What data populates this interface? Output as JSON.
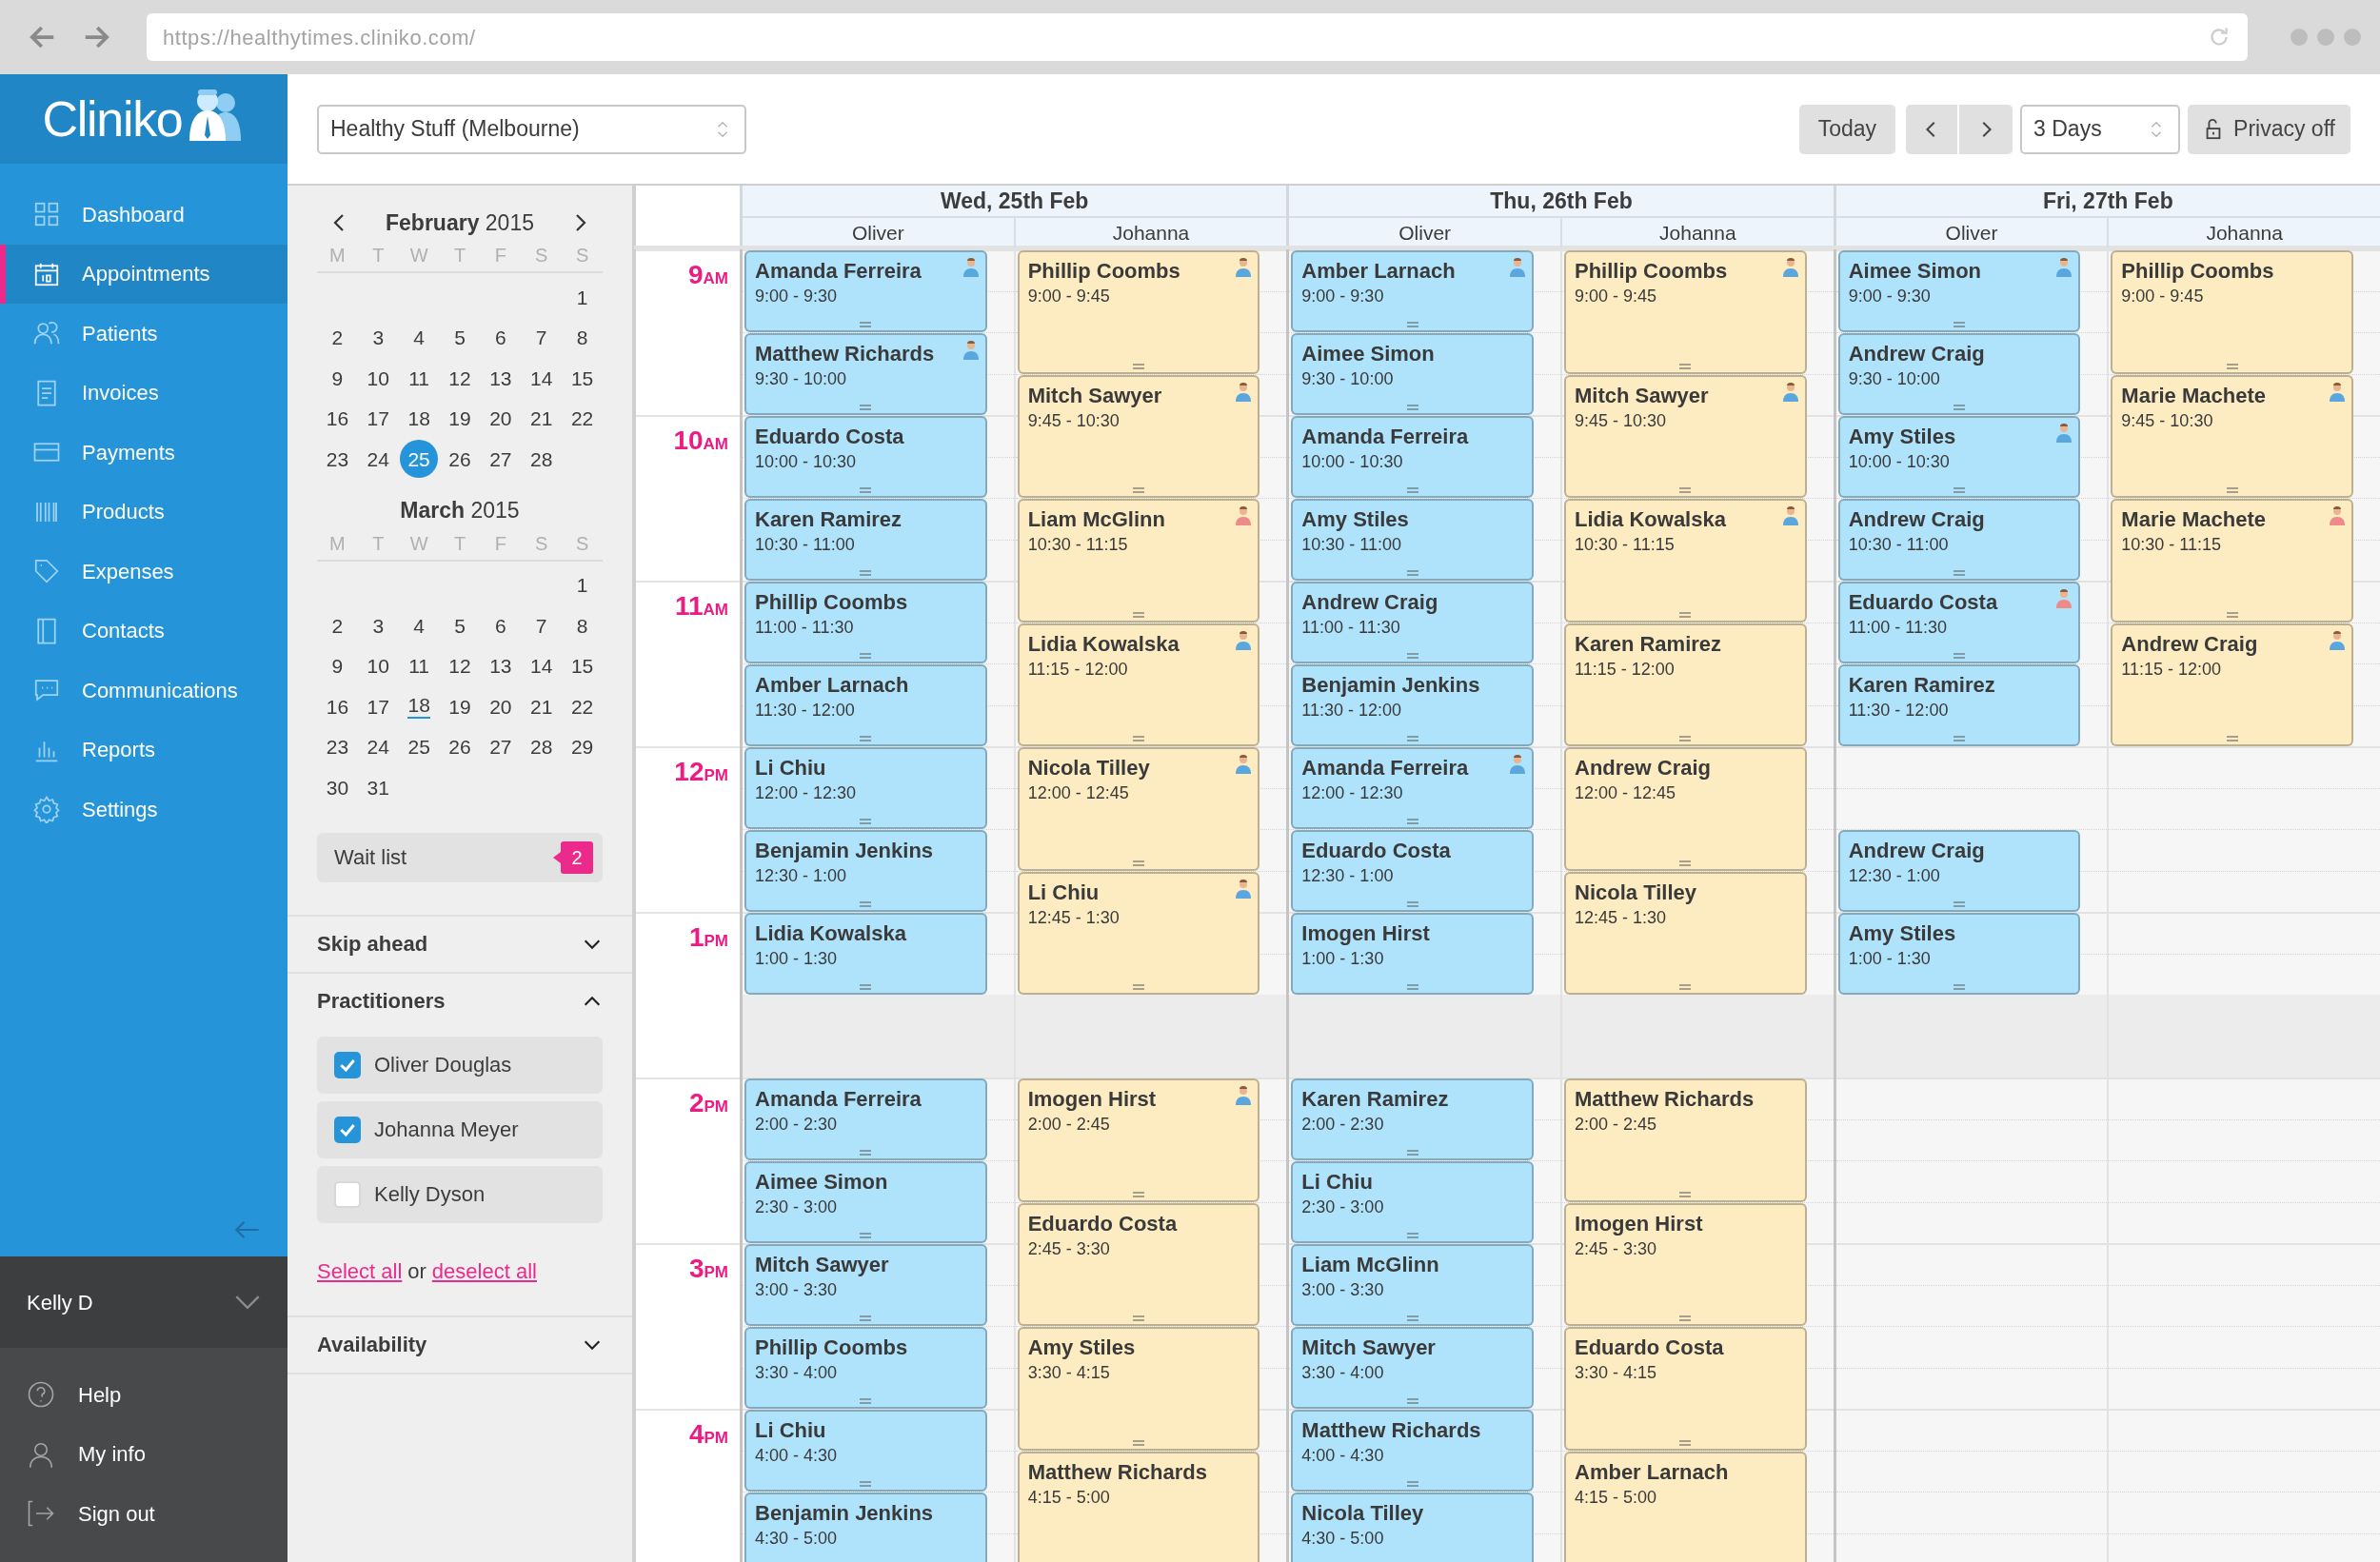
{
  "browser": {
    "url": "https://healthytimes.cliniko.com/"
  },
  "sidebar": {
    "logo": "Cliniko",
    "nav": [
      {
        "label": "Dashboard",
        "selected": false
      },
      {
        "label": "Appointments",
        "selected": true
      },
      {
        "label": "Patients",
        "selected": false
      },
      {
        "label": "Invoices",
        "selected": false
      },
      {
        "label": "Payments",
        "selected": false
      },
      {
        "label": "Products",
        "selected": false
      },
      {
        "label": "Expenses",
        "selected": false
      },
      {
        "label": "Contacts",
        "selected": false
      },
      {
        "label": "Communications",
        "selected": false
      },
      {
        "label": "Reports",
        "selected": false
      },
      {
        "label": "Settings",
        "selected": false
      }
    ],
    "user": "Kelly D",
    "footer": [
      "Help",
      "My info",
      "Sign out"
    ]
  },
  "toolbar": {
    "location": "Healthy Stuff (Melbourne)",
    "today": "Today",
    "view": "3 Days",
    "privacy": "Privacy off"
  },
  "mini_calendars": [
    {
      "title": "**February** 2015",
      "weekdays": [
        "M",
        "T",
        "W",
        "T",
        "F",
        "S",
        "S"
      ],
      "weeks": [
        [
          {
            "label": "1",
            "selected": false,
            "today": false
          }
        ],
        [
          {
            "label": "2",
            "selected": false,
            "today": false
          },
          {
            "label": "3",
            "selected": false,
            "today": false
          },
          {
            "label": "4",
            "selected": false,
            "today": false
          },
          {
            "label": "5",
            "selected": false,
            "today": false
          },
          {
            "label": "6",
            "selected": false,
            "today": false
          },
          {
            "label": "7",
            "selected": false,
            "today": false
          },
          {
            "label": "8",
            "selected": false,
            "today": false
          }
        ],
        [
          {
            "label": "9",
            "selected": false,
            "today": false
          },
          {
            "label": "10",
            "selected": false,
            "today": false
          },
          {
            "label": "11",
            "selected": false,
            "today": false
          },
          {
            "label": "12",
            "selected": false,
            "today": false
          },
          {
            "label": "13",
            "selected": false,
            "today": false
          },
          {
            "label": "14",
            "selected": false,
            "today": false
          },
          {
            "label": "15",
            "selected": false,
            "today": false
          }
        ],
        [
          {
            "label": "16",
            "selected": false,
            "today": false
          },
          {
            "label": "17",
            "selected": false,
            "today": false
          },
          {
            "label": "18",
            "selected": false,
            "today": false
          },
          {
            "label": "19",
            "selected": false,
            "today": false
          },
          {
            "label": "20",
            "selected": false,
            "today": false
          },
          {
            "label": "21",
            "selected": false,
            "today": false
          },
          {
            "label": "22",
            "selected": false,
            "today": false
          }
        ],
        [
          {
            "label": "23",
            "selected": false,
            "today": false
          },
          {
            "label": "24",
            "selected": false,
            "today": false
          },
          {
            "label": "25",
            "selected": true,
            "today": false
          },
          {
            "label": "26",
            "selected": false,
            "today": false
          },
          {
            "label": "27",
            "selected": false,
            "today": false
          },
          {
            "label": "28",
            "selected": false,
            "today": false
          }
        ]
      ]
    },
    {
      "title": "**March** 2015",
      "weekdays": [
        "M",
        "T",
        "W",
        "T",
        "F",
        "S",
        "S"
      ],
      "weeks": [
        [
          {
            "label": "1",
            "selected": false,
            "today": false
          }
        ],
        [
          {
            "label": "2",
            "selected": false,
            "today": false
          },
          {
            "label": "3",
            "selected": false,
            "today": false
          },
          {
            "label": "4",
            "selected": false,
            "today": false
          },
          {
            "label": "5",
            "selected": false,
            "today": false
          },
          {
            "label": "6",
            "selected": false,
            "today": false
          },
          {
            "label": "7",
            "selected": false,
            "today": false
          },
          {
            "label": "8",
            "selected": false,
            "today": false
          }
        ],
        [
          {
            "label": "9",
            "selected": false,
            "today": false
          },
          {
            "label": "10",
            "selected": false,
            "today": false
          },
          {
            "label": "11",
            "selected": false,
            "today": false
          },
          {
            "label": "12",
            "selected": false,
            "today": false
          },
          {
            "label": "13",
            "selected": false,
            "today": false
          },
          {
            "label": "14",
            "selected": false,
            "today": false
          },
          {
            "label": "15",
            "selected": false,
            "today": false
          }
        ],
        [
          {
            "label": "16",
            "selected": false,
            "today": false
          },
          {
            "label": "17",
            "selected": false,
            "today": false
          },
          {
            "label": "18",
            "selected": false,
            "today": true
          },
          {
            "label": "19",
            "selected": false,
            "today": false
          },
          {
            "label": "20",
            "selected": false,
            "today": false
          },
          {
            "label": "21",
            "selected": false,
            "today": false
          },
          {
            "label": "22",
            "selected": false,
            "today": false
          }
        ],
        [
          {
            "label": "23",
            "selected": false,
            "today": false
          },
          {
            "label": "24",
            "selected": false,
            "today": false
          },
          {
            "label": "25",
            "selected": false,
            "today": false
          },
          {
            "label": "26",
            "selected": false,
            "today": false
          },
          {
            "label": "27",
            "selected": false,
            "today": false
          },
          {
            "label": "28",
            "selected": false,
            "today": false
          },
          {
            "label": "29",
            "selected": false,
            "today": false
          }
        ],
        [
          {
            "label": "30",
            "selected": false,
            "today": false
          },
          {
            "label": "31",
            "selected": false,
            "today": false
          }
        ]
      ]
    }
  ],
  "wait_list": {
    "label": "Wait list",
    "count": "2"
  },
  "sections": [
    {
      "title": "Skip ahead",
      "expanded": false
    },
    {
      "title": "Practitioners",
      "expanded": true,
      "practitioners": [
        {
          "name": "Oliver Douglas",
          "checked": true
        },
        {
          "name": "Johanna Meyer",
          "checked": true
        },
        {
          "name": "Kelly Dyson",
          "checked": false
        }
      ],
      "select_all": "Select all",
      "or": "or",
      "deselect_all": "deselect all"
    },
    {
      "title": "Availability",
      "expanded": false
    }
  ],
  "calendar": {
    "hours": [
      {
        "hour": "9",
        "period": "AM"
      },
      {
        "hour": "10",
        "period": "AM"
      },
      {
        "hour": "11",
        "period": "AM"
      },
      {
        "hour": "12",
        "period": "PM"
      },
      {
        "hour": "1",
        "period": "PM"
      },
      {
        "hour": "2",
        "period": "PM"
      },
      {
        "hour": "3",
        "period": "PM"
      },
      {
        "hour": "4",
        "period": "PM"
      }
    ],
    "days": [
      {
        "label": "Wed, 25th Feb",
        "practitioners": [
          {
            "name": "Oliver",
            "color": "#afe2fb",
            "appointments": [
              {
                "patient": "Amanda Ferreira",
                "time": "9:00 - 9:30",
                "color": "#5aa7e0"
              },
              {
                "patient": "Matthew Richards",
                "time": "9:30 - 10:00",
                "color": "#5aa7e0"
              },
              {
                "patient": "Eduardo Costa",
                "time": "10:00 - 10:30"
              },
              {
                "patient": "Karen Ramirez",
                "time": "10:30 - 11:00"
              },
              {
                "patient": "Phillip Coombs",
                "time": "11:00 - 11:30"
              },
              {
                "patient": "Amber Larnach",
                "time": "11:30 - 12:00"
              },
              {
                "patient": "Li Chiu",
                "time": "12:00 - 12:30"
              },
              {
                "patient": "Benjamin Jenkins",
                "time": "12:30 - 1:00"
              },
              {
                "patient": "Lidia Kowalska",
                "time": "1:00 - 1:30"
              },
              {
                "patient": "Amanda Ferreira",
                "time": "2:00 - 2:30"
              },
              {
                "patient": "Aimee Simon",
                "time": "2:30 - 3:00"
              },
              {
                "patient": "Mitch Sawyer",
                "time": "3:00 - 3:30"
              },
              {
                "patient": "Phillip Coombs",
                "time": "3:30 - 4:00"
              },
              {
                "patient": "Li Chiu",
                "time": "4:00 - 4:30"
              },
              {
                "patient": "Benjamin Jenkins",
                "time": "4:30 - 5:00"
              }
            ]
          },
          {
            "name": "Johanna",
            "color": "#fdebc1",
            "appointments": [
              {
                "patient": "Phillip Coombs",
                "time": "9:00 - 9:45",
                "color": "#5aa7e0"
              },
              {
                "patient": "Mitch Sawyer",
                "time": "9:45 - 10:30",
                "color": "#5aa7e0"
              },
              {
                "patient": "Liam McGlinn",
                "time": "10:30 - 11:15",
                "color": "#ee8a8a"
              },
              {
                "patient": "Lidia Kowalska",
                "time": "11:15 - 12:00",
                "color": "#5aa7e0"
              },
              {
                "patient": "Nicola Tilley",
                "time": "12:00 - 12:45",
                "color": "#5aa7e0"
              },
              {
                "patient": "Li Chiu",
                "time": "12:45 - 1:30",
                "color": "#5aa7e0"
              },
              {
                "patient": "Imogen Hirst",
                "time": "2:00 - 2:45",
                "color": "#5aa7e0"
              },
              {
                "patient": "Eduardo Costa",
                "time": "2:45 - 3:30"
              },
              {
                "patient": "Amy Stiles",
                "time": "3:30 - 4:15"
              },
              {
                "patient": "Matthew Richards",
                "time": "4:15 - 5:00"
              }
            ]
          }
        ]
      },
      {
        "label": "Thu, 26th Feb",
        "practitioners": [
          {
            "name": "Oliver",
            "color": "#afe2fb",
            "appointments": [
              {
                "patient": "Amber Larnach",
                "time": "9:00 - 9:30",
                "color": "#5aa7e0"
              },
              {
                "patient": "Aimee Simon",
                "time": "9:30 - 10:00"
              },
              {
                "patient": "Amanda Ferreira",
                "time": "10:00 - 10:30"
              },
              {
                "patient": "Amy Stiles",
                "time": "10:30 - 11:00"
              },
              {
                "patient": "Andrew Craig",
                "time": "11:00 - 11:30"
              },
              {
                "patient": "Benjamin Jenkins",
                "time": "11:30 - 12:00"
              },
              {
                "patient": "Amanda Ferreira",
                "time": "12:00 - 12:30",
                "color": "#5aa7e0"
              },
              {
                "patient": "Eduardo Costa",
                "time": "12:30 - 1:00"
              },
              {
                "patient": "Imogen Hirst",
                "time": "1:00 - 1:30"
              },
              {
                "patient": "Karen Ramirez",
                "time": "2:00 - 2:30"
              },
              {
                "patient": "Li Chiu",
                "time": "2:30 - 3:00"
              },
              {
                "patient": "Liam McGlinn",
                "time": "3:00 - 3:30"
              },
              {
                "patient": "Mitch Sawyer",
                "time": "3:30 - 4:00"
              },
              {
                "patient": "Matthew Richards",
                "time": "4:00 - 4:30"
              },
              {
                "patient": "Nicola Tilley",
                "time": "4:30 - 5:00"
              }
            ]
          },
          {
            "name": "Johanna",
            "color": "#fdebc1",
            "appointments": [
              {
                "patient": "Phillip Coombs",
                "time": "9:00 - 9:45",
                "color": "#5aa7e0"
              },
              {
                "patient": "Mitch Sawyer",
                "time": "9:45 - 10:30",
                "color": "#5aa7e0"
              },
              {
                "patient": "Lidia Kowalska",
                "time": "10:30 - 11:15",
                "color": "#5aa7e0"
              },
              {
                "patient": "Karen Ramirez",
                "time": "11:15 - 12:00"
              },
              {
                "patient": "Andrew Craig",
                "time": "12:00 - 12:45"
              },
              {
                "patient": "Nicola Tilley",
                "time": "12:45 - 1:30"
              },
              {
                "patient": "Matthew Richards",
                "time": "2:00 - 2:45"
              },
              {
                "patient": "Imogen Hirst",
                "time": "2:45 - 3:30"
              },
              {
                "patient": "Eduardo Costa",
                "time": "3:30 - 4:15"
              },
              {
                "patient": "Amber Larnach",
                "time": "4:15 - 5:00"
              }
            ]
          }
        ]
      },
      {
        "label": "Fri, 27th Feb",
        "practitioners": [
          {
            "name": "Oliver",
            "color": "#afe2fb",
            "appointments": [
              {
                "patient": "Aimee Simon",
                "time": "9:00 - 9:30",
                "color": "#5aa7e0"
              },
              {
                "patient": "Andrew Craig",
                "time": "9:30 - 10:00"
              },
              {
                "patient": "Amy Stiles",
                "time": "10:00 - 10:30",
                "color": "#5aa7e0"
              },
              {
                "patient": "Andrew Craig",
                "time": "10:30 - 11:00"
              },
              {
                "patient": "Eduardo Costa",
                "time": "11:00 - 11:30",
                "color": "#ee8a8a"
              },
              {
                "patient": "Karen Ramirez",
                "time": "11:30 - 12:00"
              },
              {
                "patient": "Andrew Craig",
                "time": "12:30 - 1:00"
              },
              {
                "patient": "Amy Stiles",
                "time": "1:00 - 1:30"
              }
            ]
          },
          {
            "name": "Johanna",
            "color": "#fdebc1",
            "appointments": [
              {
                "patient": "Phillip Coombs",
                "time": "9:00 - 9:45"
              },
              {
                "patient": "Marie Machete",
                "time": "9:45 - 10:30",
                "color": "#5aa7e0"
              },
              {
                "patient": "Marie Machete",
                "time": "10:30 - 11:15",
                "color": "#ee8a8a"
              },
              {
                "patient": "Andrew Craig",
                "time": "11:15 - 12:00",
                "color": "#5aa7e0"
              }
            ]
          }
        ]
      }
    ]
  }
}
